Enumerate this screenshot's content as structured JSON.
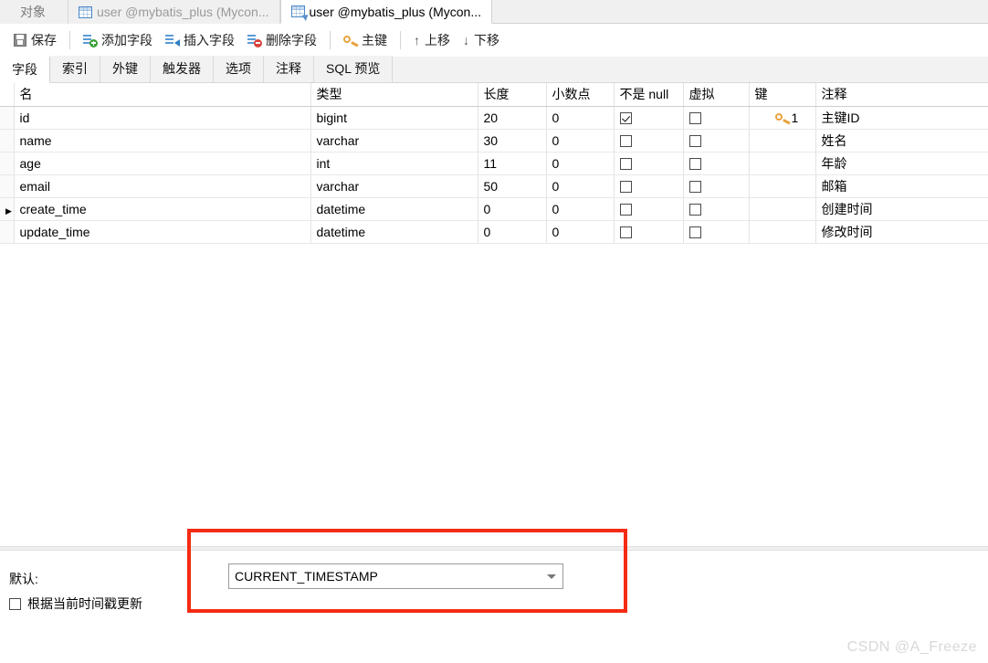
{
  "tabbar": {
    "tabs": [
      {
        "label": "对象",
        "icon": "",
        "active": false
      },
      {
        "label": "user @mybatis_plus (Mycon...",
        "icon": "table-icon",
        "active": false
      },
      {
        "label": "user @mybatis_plus (Mycon...",
        "icon": "table-design-icon",
        "active": true
      }
    ]
  },
  "toolbar": {
    "save_label": "保存",
    "add_field_label": "添加字段",
    "insert_field_label": "插入字段",
    "delete_field_label": "删除字段",
    "primary_key_label": "主键",
    "move_up_label": "上移",
    "move_down_label": "下移",
    "move_up_glyph": "↑",
    "move_down_glyph": "↓"
  },
  "subtabs": {
    "items": [
      {
        "label": "字段",
        "active": true
      },
      {
        "label": "索引",
        "active": false
      },
      {
        "label": "外键",
        "active": false
      },
      {
        "label": "触发器",
        "active": false
      },
      {
        "label": "选项",
        "active": false
      },
      {
        "label": "注释",
        "active": false
      },
      {
        "label": "SQL 预览",
        "active": false
      }
    ]
  },
  "grid": {
    "columns": [
      "名",
      "类型",
      "长度",
      "小数点",
      "不是 null",
      "虚拟",
      "键",
      "注释"
    ],
    "rows": [
      {
        "selected": false,
        "marker": "",
        "name": "id",
        "type": "bigint",
        "length": "20",
        "decimals": "0",
        "not_null": true,
        "virtual": false,
        "key": "1",
        "comment": "主键ID"
      },
      {
        "selected": false,
        "marker": "",
        "name": "name",
        "type": "varchar",
        "length": "30",
        "decimals": "0",
        "not_null": false,
        "virtual": false,
        "key": "",
        "comment": "姓名"
      },
      {
        "selected": false,
        "marker": "",
        "name": "age",
        "type": "int",
        "length": "11",
        "decimals": "0",
        "not_null": false,
        "virtual": false,
        "key": "",
        "comment": "年龄"
      },
      {
        "selected": false,
        "marker": "",
        "name": "email",
        "type": "varchar",
        "length": "50",
        "decimals": "0",
        "not_null": false,
        "virtual": false,
        "key": "",
        "comment": "邮箱"
      },
      {
        "selected": true,
        "marker": "▶",
        "name": "create_time",
        "type": "datetime",
        "length": "0",
        "decimals": "0",
        "not_null": false,
        "virtual": false,
        "key": "",
        "comment": "创建时间"
      },
      {
        "selected": false,
        "marker": "",
        "name": "update_time",
        "type": "datetime",
        "length": "0",
        "decimals": "0",
        "not_null": false,
        "virtual": false,
        "key": "",
        "comment": "修改时间"
      }
    ]
  },
  "bottom": {
    "default_label": "默认:",
    "default_value": "CURRENT_TIMESTAMP",
    "update_on_timestamp_label": "根据当前时间戳更新",
    "update_on_timestamp_checked": false
  },
  "highlight": {
    "color": "#f42b12"
  },
  "watermark": {
    "text": "CSDN @A_Freeze"
  }
}
